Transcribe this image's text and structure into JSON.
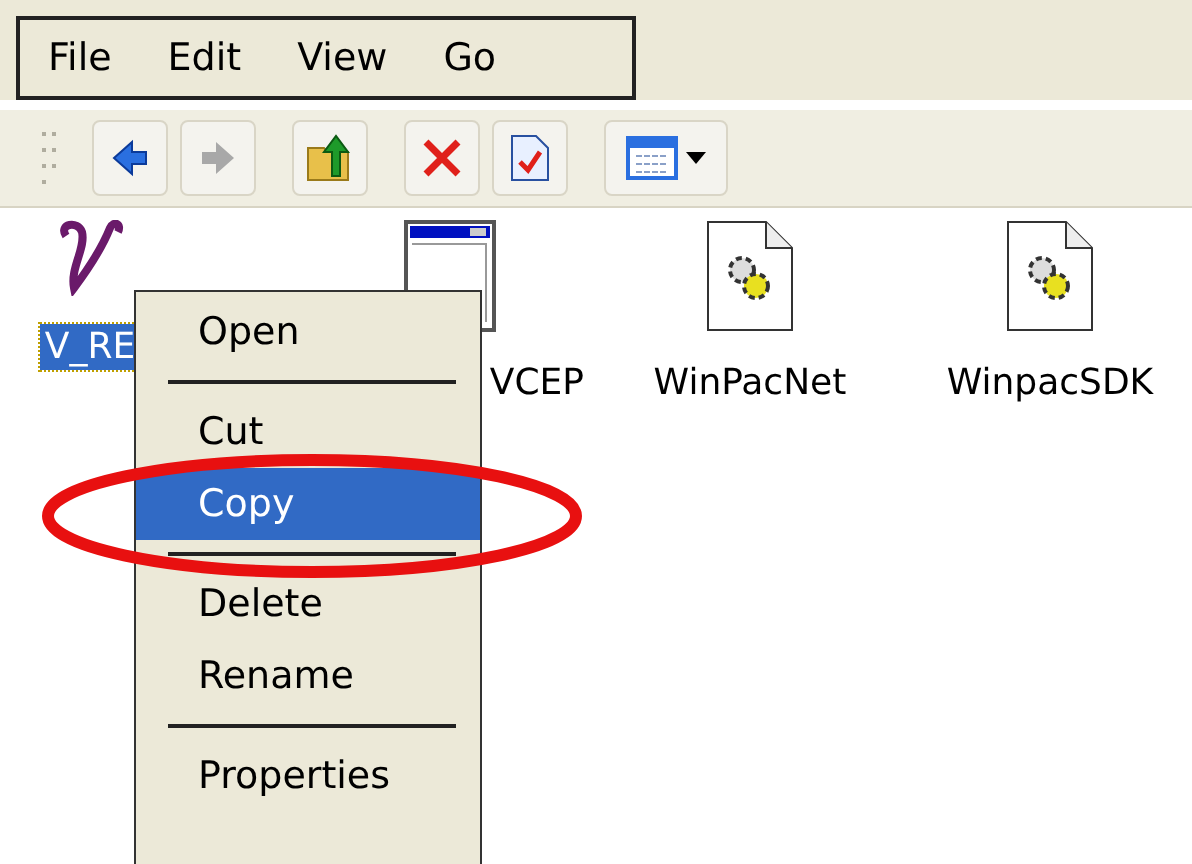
{
  "menu_bar": [
    "File",
    "Edit",
    "View",
    "Go"
  ],
  "toolbar": [
    {
      "kind": "back",
      "disabled": false
    },
    {
      "kind": "forward",
      "disabled": true
    },
    {
      "kind": "up",
      "disabled": false
    },
    {
      "kind": "delete",
      "disabled": false
    },
    {
      "kind": "properties",
      "disabled": false
    },
    {
      "kind": "views",
      "disabled": false
    }
  ],
  "files": [
    {
      "kind": "app",
      "name": "V_RE",
      "selected": true
    },
    {
      "kind": "window",
      "name": "VCEP",
      "selected": false
    },
    {
      "kind": "config",
      "name": "WinPacNet",
      "selected": false
    },
    {
      "kind": "config",
      "name": "WinpacSDK",
      "selected": false
    }
  ],
  "context_menu": [
    {
      "kind": "item",
      "label": "Open",
      "selected": false
    },
    {
      "kind": "separator"
    },
    {
      "kind": "item",
      "label": "Cut",
      "selected": false
    },
    {
      "kind": "item",
      "label": "Copy",
      "selected": true
    },
    {
      "kind": "separator"
    },
    {
      "kind": "item",
      "label": "Delete",
      "selected": false
    },
    {
      "kind": "item",
      "label": "Rename",
      "selected": false
    },
    {
      "kind": "separator"
    },
    {
      "kind": "item",
      "label": "Properties",
      "selected": false
    }
  ]
}
